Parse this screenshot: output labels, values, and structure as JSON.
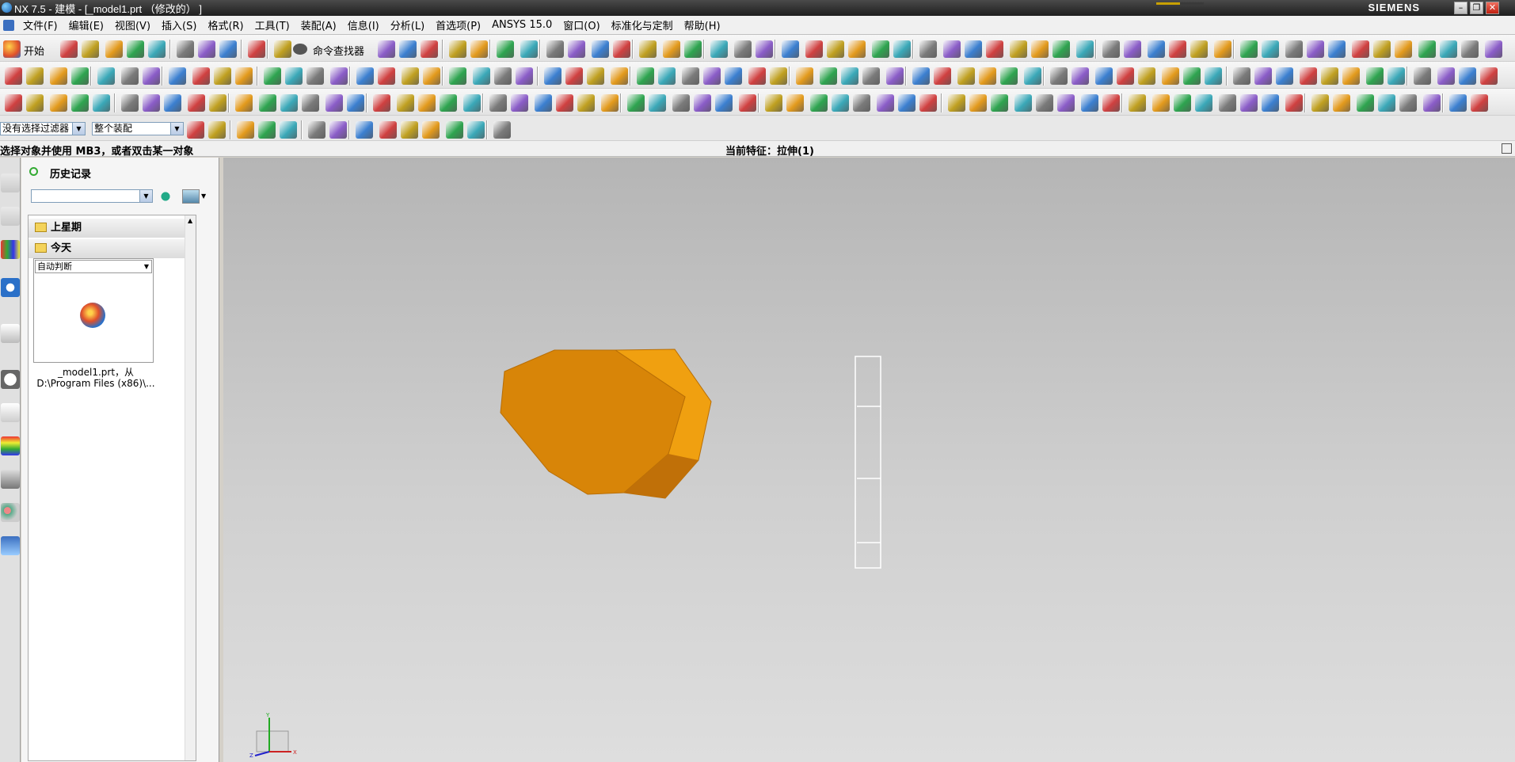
{
  "window": {
    "title": "NX 7.5 - 建模 - [_model1.prt （修改的） ]",
    "brand": "SIEMENS",
    "progress": 0.5
  },
  "menu": [
    "文件(F)",
    "编辑(E)",
    "视图(V)",
    "插入(S)",
    "格式(R)",
    "工具(T)",
    "装配(A)",
    "信息(I)",
    "分析(L)",
    "首选项(P)",
    "ANSYS 15.0",
    "窗口(O)",
    "标准化与定制",
    "帮助(H)"
  ],
  "toolbar": {
    "start_label": "开始",
    "command_finder_label": "命令查找器"
  },
  "selection": {
    "filter": "没有选择过滤器",
    "scope": "整个装配"
  },
  "status": {
    "prompt": "选择对象并使用 MB3，或者双击某一对象",
    "current_feature": "当前特征：拉伸(1)"
  },
  "history": {
    "title": "历史记录",
    "groups": [
      "上星期",
      "今天"
    ],
    "thumb_mode": "自动判断",
    "file_line1": "_model1.prt，从",
    "file_line2": "D:\\Program Files (x86)\\..."
  },
  "colors": {
    "part_face": "#d88508",
    "part_side": "#f0a010",
    "part_edge": "#b86e06",
    "wireframe": "#ffffff"
  },
  "triad": {
    "x": "X",
    "y": "Y",
    "z": "Z"
  }
}
